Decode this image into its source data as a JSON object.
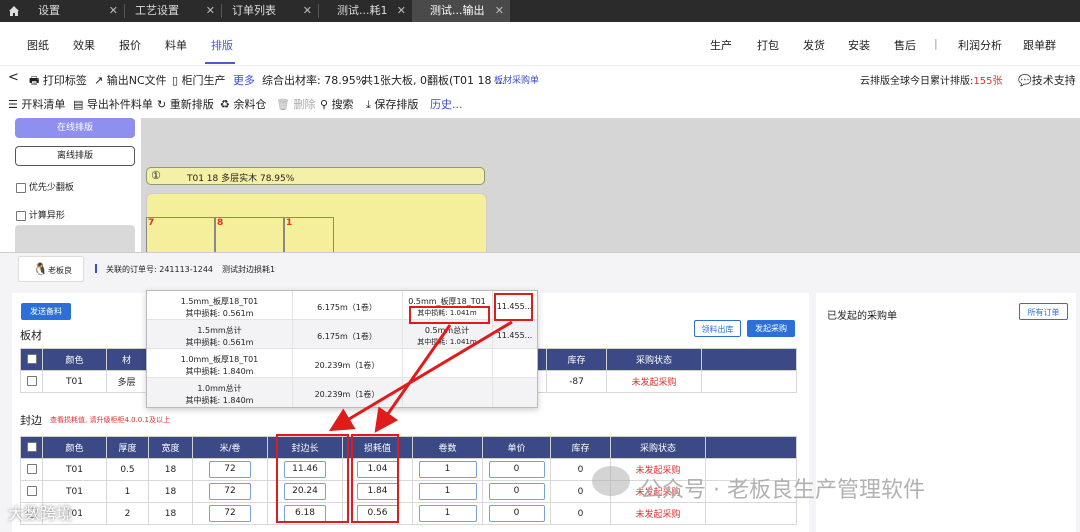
{
  "tabs": [
    {
      "label": "设置"
    },
    {
      "label": "工艺设置"
    },
    {
      "label": "订单列表"
    },
    {
      "label": "测试...耗1"
    },
    {
      "label": "测试...输出"
    }
  ],
  "nav_left": [
    "图纸",
    "效果",
    "报价",
    "料单",
    "排版"
  ],
  "nav_right": [
    "生产",
    "打包",
    "发货",
    "安装",
    "售后",
    "利润分析",
    "跟单群"
  ],
  "nav_right_sep": "|",
  "toolbar1": {
    "back": "<",
    "print": "打印标签",
    "nc": "输出NC文件",
    "door": "柜门生产",
    "more": "更多",
    "rate": "综合出材率: 78.95%",
    "summary": "共1张大板, 0翻板(T01 18 ...",
    "purchase": "板材采购单",
    "cloud_prefix": "云排版全球今日累计排版:",
    "cloud_count": "155张",
    "support": "技术支持"
  },
  "toolbar2": {
    "cutlist": "开料清单",
    "export_parts": "导出补件料单",
    "relayout": "重新排版",
    "leftover": "余料仓",
    "delete": "删除",
    "search": "搜索",
    "save": "保存排版",
    "history": "历史..."
  },
  "leftpanel": {
    "online": "在线排版",
    "offline": "离线排版",
    "prefer_flip": "优先少翻板",
    "calc_irregular": "计算异形"
  },
  "canvas": {
    "sheet_num": "①",
    "sheet_title": "T01 18 多层实木 78.95%",
    "part_labels": [
      "7",
      "8",
      "1"
    ]
  },
  "panel": {
    "logo_text": "老板良",
    "order_label": "关联的订单号: 241113-1244",
    "order_name": "测试封边损耗1",
    "send_btn": "发送备料",
    "board_title": "板材",
    "board_btn1": "领料出库",
    "board_btn2": "发起采购",
    "board_headers": [
      "颜色",
      "材",
      "库存",
      "采购状态"
    ],
    "board_rows": [
      {
        "color": "T01",
        "mat": "多层",
        "stock": "-87",
        "status": "未发起采购"
      }
    ],
    "edge_title": "封边",
    "edge_note": "查看损耗值, 请升级柜柜4.0.0.1及以上",
    "edge_headers": [
      "颜色",
      "厚度",
      "宽度",
      "米/卷",
      "封边长",
      "损耗值",
      "卷数",
      "单价",
      "库存",
      "采购状态"
    ],
    "edge_rows": [
      {
        "color": "T01",
        "thick": "0.5",
        "width": "18",
        "mpr": "72",
        "len": "11.46",
        "loss": "1.04",
        "rolls": "1",
        "price": "0",
        "stock": "0",
        "status": "未发起采购"
      },
      {
        "color": "T01",
        "thick": "1",
        "width": "18",
        "mpr": "72",
        "len": "20.24",
        "loss": "1.84",
        "rolls": "1",
        "price": "0",
        "stock": "0",
        "status": "未发起采购"
      },
      {
        "color": "T01",
        "thick": "2",
        "width": "18",
        "mpr": "72",
        "len": "6.18",
        "loss": "0.56",
        "rolls": "1",
        "price": "0",
        "stock": "0",
        "status": "未发起采购"
      }
    ],
    "right_title": "已发起的采购单",
    "all_orders": "所有订单"
  },
  "popup": {
    "rows": [
      {
        "name": "1.5mm_板厚18_T01",
        "loss": "其中损耗: 0.561m",
        "len": "6.175m（1卷）",
        "name2": "0.5mm_板厚18_T01",
        "loss2": "其中损耗: 1.041m",
        "val": "11.455..."
      },
      {
        "name": "1.5mm总计",
        "loss": "其中损耗: 0.561m",
        "len": "6.175m（1卷）",
        "name2": "0.5mm总计",
        "loss2": "其中损耗: 1.041m",
        "val": "11.455..."
      },
      {
        "name": "1.0mm_板厚18_T01",
        "loss": "其中损耗: 1.840m",
        "len": "20.239m（1卷）"
      },
      {
        "name": "1.0mm总计",
        "loss": "其中损耗: 1.840m",
        "len": "20.239m（1卷）"
      }
    ]
  },
  "watermarks": {
    "left": "大数跨境",
    "right": "公众号 · 老板良生产管理软件"
  },
  "colors": {
    "accent": "#4a5bd4",
    "header": "#3b4a86",
    "highlight": "#e01b1b",
    "sheet": "#f5ee9a"
  }
}
